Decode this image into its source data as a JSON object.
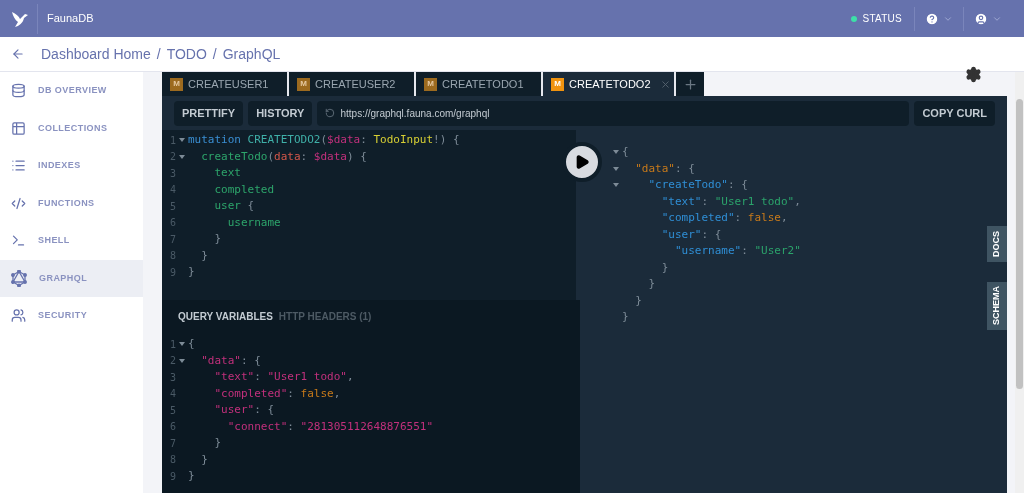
{
  "app_bar": {
    "title": "FaunaDB",
    "status": "STATUS"
  },
  "breadcrumb": {
    "separator": "/",
    "items": [
      "Dashboard Home",
      "TODO",
      "GraphQL"
    ]
  },
  "sidebar": {
    "items": [
      {
        "label": "DB OVERVIEW",
        "selected": false
      },
      {
        "label": "COLLECTIONS",
        "selected": false
      },
      {
        "label": "INDEXES",
        "selected": false
      },
      {
        "label": "FUNCTIONS",
        "selected": false
      },
      {
        "label": "SHELL",
        "selected": false
      },
      {
        "label": "GRAPHQL",
        "selected": true
      },
      {
        "label": "SECURITY",
        "selected": false
      }
    ]
  },
  "tabs": [
    {
      "badge": "M",
      "label": "CREATEUSER1",
      "selected": false
    },
    {
      "badge": "M",
      "label": "CREATEUSER2",
      "selected": false
    },
    {
      "badge": "M",
      "label": "CREATETODO1",
      "selected": false
    },
    {
      "badge": "M",
      "label": "CREATETODO2",
      "selected": true
    }
  ],
  "toolbar": {
    "buttons": [
      "PRETTIFY",
      "HISTORY"
    ],
    "url": "https://graphql.fauna.com/graphql",
    "copy": "COPY CURL"
  },
  "query": [
    {
      "number": "1",
      "fold": true,
      "tokens": [
        {
          "kind": "keyword",
          "text": "mutation "
        },
        {
          "kind": "def",
          "text": "CREATETODO2"
        },
        {
          "kind": "punct",
          "text": "("
        },
        {
          "kind": "variable",
          "text": "$data"
        },
        {
          "kind": "punct",
          "text": ": "
        },
        {
          "kind": "type",
          "text": "TodoInput"
        },
        {
          "kind": "punct",
          "text": "!) {"
        }
      ]
    },
    {
      "number": "2",
      "fold": true,
      "tokens": [
        {
          "kind": "field",
          "text": "  createTodo"
        },
        {
          "kind": "punct",
          "text": "("
        },
        {
          "kind": "arg",
          "text": "data"
        },
        {
          "kind": "punct",
          "text": ": "
        },
        {
          "kind": "variable",
          "text": "$data"
        },
        {
          "kind": "punct",
          "text": ") {"
        }
      ]
    },
    {
      "number": "3",
      "fold": false,
      "tokens": [
        {
          "kind": "field",
          "text": "    text"
        }
      ]
    },
    {
      "number": "4",
      "fold": false,
      "tokens": [
        {
          "kind": "field",
          "text": "    completed"
        }
      ]
    },
    {
      "number": "5",
      "fold": false,
      "tokens": [
        {
          "kind": "field",
          "text": "    user"
        },
        {
          "kind": "punct",
          "text": " {"
        }
      ]
    },
    {
      "number": "6",
      "fold": false,
      "tokens": [
        {
          "kind": "field",
          "text": "      username"
        }
      ]
    },
    {
      "number": "7",
      "fold": false,
      "tokens": [
        {
          "kind": "punct",
          "text": "    }"
        }
      ]
    },
    {
      "number": "8",
      "fold": false,
      "tokens": [
        {
          "kind": "punct",
          "text": "  }"
        }
      ]
    },
    {
      "number": "9",
      "fold": false,
      "tokens": [
        {
          "kind": "punct",
          "text": "}"
        }
      ]
    }
  ],
  "variables_tabs": [
    {
      "label": "QUERY VARIABLES",
      "selected": true
    },
    {
      "label": "HTTP HEADERS (1)",
      "selected": false
    }
  ],
  "variables": [
    {
      "number": "1",
      "fold": true,
      "tokens": [
        {
          "kind": "punct",
          "text": "{"
        }
      ]
    },
    {
      "number": "2",
      "fold": true,
      "tokens": [
        {
          "kind": "vkey",
          "text": "  \"data\""
        },
        {
          "kind": "punct",
          "text": ": {"
        }
      ]
    },
    {
      "number": "3",
      "fold": false,
      "tokens": [
        {
          "kind": "vkey",
          "text": "    \"text\""
        },
        {
          "kind": "punct",
          "text": ": "
        },
        {
          "kind": "vstring",
          "text": "\"User1 todo\""
        },
        {
          "kind": "punct",
          "text": ","
        }
      ]
    },
    {
      "number": "4",
      "fold": false,
      "tokens": [
        {
          "kind": "vkey",
          "text": "    \"completed\""
        },
        {
          "kind": "punct",
          "text": ": "
        },
        {
          "kind": "bool",
          "text": "false"
        },
        {
          "kind": "punct",
          "text": ","
        }
      ]
    },
    {
      "number": "5",
      "fold": false,
      "tokens": [
        {
          "kind": "vkey",
          "text": "    \"user\""
        },
        {
          "kind": "punct",
          "text": ": {"
        }
      ]
    },
    {
      "number": "6",
      "fold": false,
      "tokens": [
        {
          "kind": "vkey",
          "text": "      \"connect\""
        },
        {
          "kind": "punct",
          "text": ": "
        },
        {
          "kind": "vstring",
          "text": "\"281305112648876551\""
        }
      ]
    },
    {
      "number": "7",
      "fold": false,
      "tokens": [
        {
          "kind": "punct",
          "text": "    }"
        }
      ]
    },
    {
      "number": "8",
      "fold": false,
      "tokens": [
        {
          "kind": "punct",
          "text": "  }"
        }
      ]
    },
    {
      "number": "9",
      "fold": false,
      "tokens": [
        {
          "kind": "punct",
          "text": "}"
        }
      ]
    }
  ],
  "result": [
    {
      "fold": true,
      "tokens": [
        {
          "kind": "punct",
          "text": "{"
        }
      ]
    },
    {
      "fold": true,
      "tokens": [
        {
          "kind": "bool",
          "text": "  \"data\""
        },
        {
          "kind": "punct",
          "text": ": {"
        }
      ]
    },
    {
      "fold": true,
      "tokens": [
        {
          "kind": "key",
          "text": "    \"createTodo\""
        },
        {
          "kind": "punct",
          "text": ": {"
        }
      ]
    },
    {
      "fold": false,
      "tokens": [
        {
          "kind": "key",
          "text": "      \"text\""
        },
        {
          "kind": "punct",
          "text": ": "
        },
        {
          "kind": "string",
          "text": "\"User1 todo\""
        },
        {
          "kind": "punct",
          "text": ","
        }
      ]
    },
    {
      "fold": false,
      "tokens": [
        {
          "kind": "key",
          "text": "      \"completed\""
        },
        {
          "kind": "punct",
          "text": ": "
        },
        {
          "kind": "bool",
          "text": "false"
        },
        {
          "kind": "punct",
          "text": ","
        }
      ]
    },
    {
      "fold": false,
      "tokens": [
        {
          "kind": "key",
          "text": "      \"user\""
        },
        {
          "kind": "punct",
          "text": ": {"
        }
      ]
    },
    {
      "fold": false,
      "tokens": [
        {
          "kind": "key",
          "text": "        \"username\""
        },
        {
          "kind": "punct",
          "text": ": "
        },
        {
          "kind": "string",
          "text": "\"User2\""
        }
      ]
    },
    {
      "fold": false,
      "tokens": [
        {
          "kind": "punct",
          "text": "      }"
        }
      ]
    },
    {
      "fold": false,
      "tokens": [
        {
          "kind": "punct",
          "text": "    }"
        }
      ]
    },
    {
      "fold": false,
      "tokens": [
        {
          "kind": "punct",
          "text": "  }"
        }
      ]
    },
    {
      "fold": false,
      "tokens": [
        {
          "kind": "punct",
          "text": "}"
        }
      ]
    }
  ],
  "side_tabs": [
    "DOCS",
    "SCHEMA"
  ]
}
